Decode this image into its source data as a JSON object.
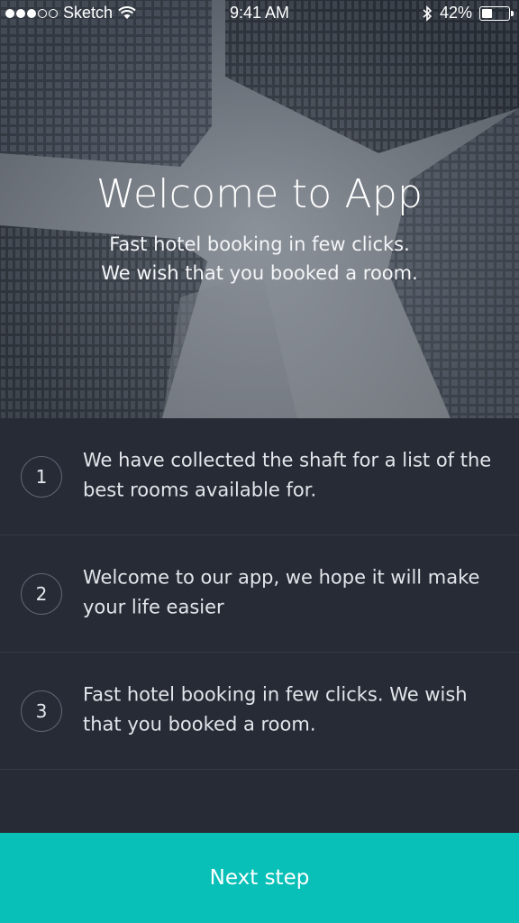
{
  "status_bar": {
    "carrier": "Sketch",
    "time": "9:41 AM",
    "battery": "42%",
    "battery_level": 0.42,
    "signal_bars_filled": 3,
    "signal_bars_total": 5,
    "icons": [
      "wifi-icon",
      "bluetooth-icon",
      "battery-icon"
    ]
  },
  "hero": {
    "title": "Welcome to App",
    "subtitle_lines": [
      "Fast hotel booking in few clicks.",
      "We wish that you booked a room."
    ]
  },
  "steps": [
    {
      "number": "1",
      "text": "We have collected the shaft for a list of the best rooms available for."
    },
    {
      "number": "2",
      "text": "Welcome to our app, we hope it will make your life easier"
    },
    {
      "number": "3",
      "text": "Fast hotel booking in few clicks. We wish that you booked a room."
    }
  ],
  "cta": {
    "label": "Next step"
  },
  "colors": {
    "list_background": "#262b36",
    "divider": "#353b47",
    "accent": "#08c0b7",
    "text": "#e2e5e9"
  }
}
